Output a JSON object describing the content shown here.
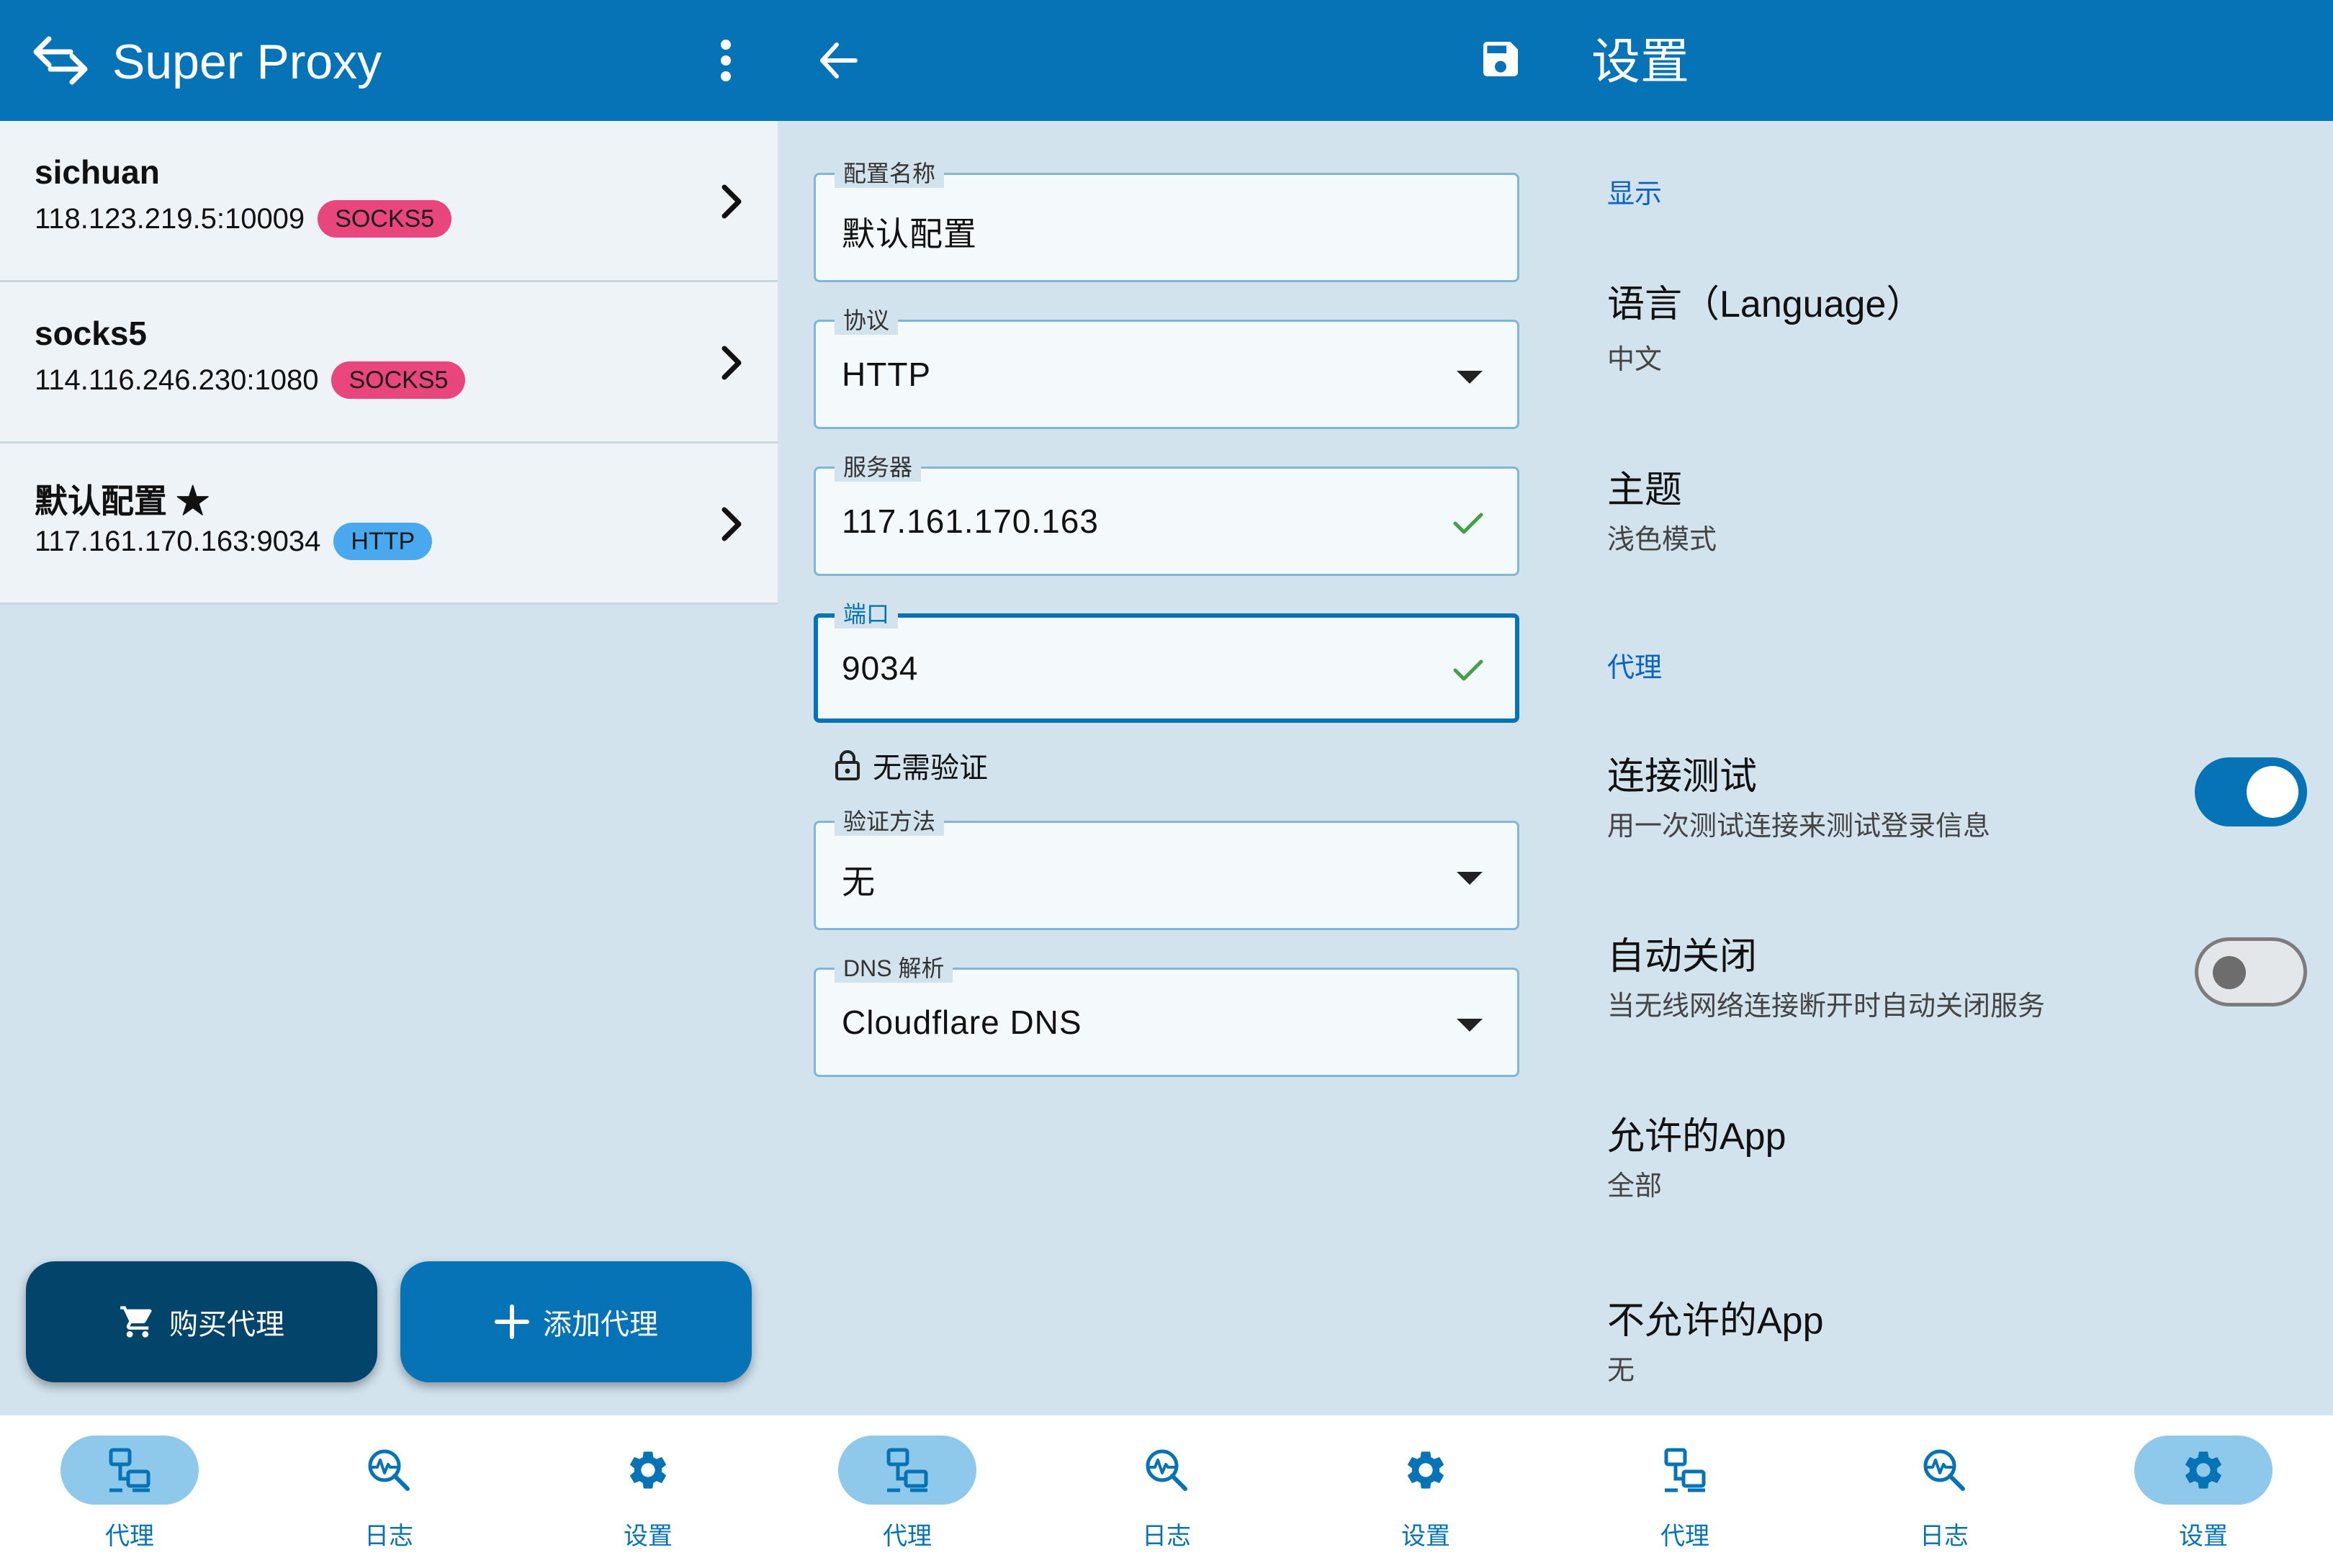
{
  "colors": {
    "primary": "#0573b5",
    "background": "#d2e3ee",
    "socks5_badge": "#e8467c",
    "http_badge": "#4aa8ee",
    "check": "#43a047",
    "buy_button": "#03446b"
  },
  "proxy_list": {
    "app_title": "Super Proxy",
    "items": [
      {
        "name": "sichuan",
        "address": "118.123.219.5:10009",
        "protocol": "SOCKS5"
      },
      {
        "name": "socks5",
        "address": "114.116.246.230:1080",
        "protocol": "SOCKS5"
      },
      {
        "name": "默认配置 ★",
        "address": "117.161.170.163:9034",
        "protocol": "HTTP"
      }
    ],
    "buy_button": "购买代理",
    "add_button": "添加代理"
  },
  "editor": {
    "fields": {
      "name": {
        "label": "配置名称",
        "value": "默认配置"
      },
      "protocol": {
        "label": "协议",
        "value": "HTTP"
      },
      "server": {
        "label": "服务器",
        "value": "117.161.170.163"
      },
      "port": {
        "label": "端口",
        "value": "9034"
      },
      "auth": {
        "label": "验证方法",
        "value": "无"
      },
      "dns": {
        "label": "DNS 解析",
        "value": "Cloudflare DNS"
      }
    },
    "no_auth_note": "无需验证"
  },
  "settings": {
    "title": "设置",
    "display_header": "显示",
    "language_title": "语言（Language）",
    "language_value": "中文",
    "theme_title": "主题",
    "theme_value": "浅色模式",
    "proxy_header": "代理",
    "conn_test_title": "连接测试",
    "conn_test_desc": "用一次测试连接来测试登录信息",
    "conn_test_enabled": true,
    "auto_close_title": "自动关闭",
    "auto_close_desc": "当无线网络连接断开时自动关闭服务",
    "auto_close_enabled": false,
    "allowed_apps_title": "允许的App",
    "allowed_apps_value": "全部",
    "disallowed_apps_title": "不允许的App",
    "disallowed_apps_value": "无"
  },
  "nav": {
    "proxy": "代理",
    "log": "日志",
    "settings": "设置"
  }
}
